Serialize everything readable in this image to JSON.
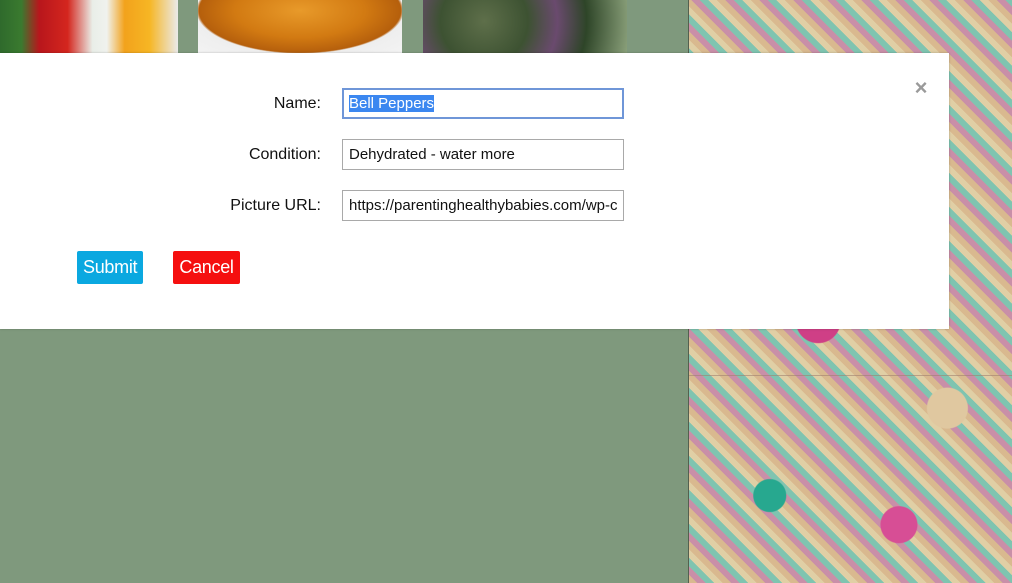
{
  "background": {
    "tiles": [
      {
        "name": "peppers-image"
      },
      {
        "name": "pumpkin-image"
      },
      {
        "name": "basil-image"
      }
    ]
  },
  "modal": {
    "close_icon": "×",
    "fields": {
      "name": {
        "label": "Name:",
        "value": "Bell Peppers"
      },
      "condition": {
        "label": "Condition:",
        "value": "Dehydrated - water more"
      },
      "picture_url": {
        "label": "Picture URL:",
        "value": "https://parentinghealthybabies.com/wp-c"
      }
    },
    "buttons": {
      "submit": "Submit",
      "cancel": "Cancel"
    }
  },
  "colors": {
    "page_bg": "#7f997d",
    "submit_bg": "#0aa8e0",
    "cancel_bg": "#f50f0f",
    "focus_border": "#6f96d8"
  }
}
